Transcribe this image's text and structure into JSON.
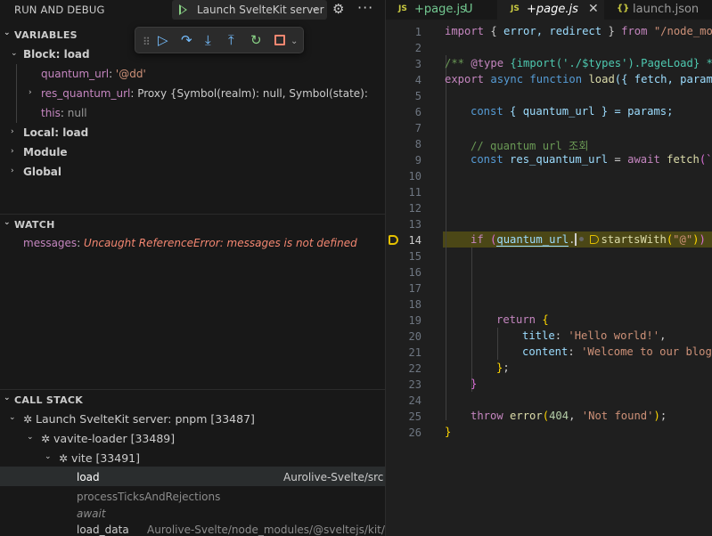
{
  "debug_bar": {
    "title": "RUN AND DEBUG",
    "launch_config": "Launch SvelteKit server",
    "play_icon": "play-icon",
    "settings_icon": "gear-icon",
    "more_icon": "ellipsis-icon"
  },
  "toolbar": {
    "icons": [
      "gripper-icon",
      "continue-icon",
      "step-over-icon",
      "step-into-icon",
      "step-out-icon",
      "restart-icon",
      "stop-icon",
      "chevron-down-icon"
    ]
  },
  "variables": {
    "header": "VARIABLES",
    "block_scope": "Block: load",
    "items": [
      {
        "name": "quantum_url",
        "sep": ": ",
        "value": "'@dd'"
      },
      {
        "name": "res_quantum_url",
        "sep": ": ",
        "value": "Proxy {Symbol(realm): null, Symbol(state): "
      },
      {
        "name": "this",
        "sep": ": ",
        "value": "null"
      }
    ],
    "scopes": [
      "Local: load",
      "Module",
      "Global"
    ]
  },
  "watch": {
    "header": "WATCH",
    "expr": "messages",
    "sep": ": ",
    "value": "Uncaught ReferenceError: messages is not defined"
  },
  "call_stack": {
    "header": "CALL STACK",
    "session": "Launch SvelteKit server: pnpm [33487]",
    "child": "vavite-loader [33489]",
    "grandchild": "vite [33491]",
    "frames": [
      {
        "name": "load",
        "source": "Aurolive-Svelte/src"
      },
      {
        "name": "processTicksAndRejections",
        "source": ""
      },
      {
        "name": "await",
        "source": ""
      },
      {
        "name": "load_data",
        "source": "Aurolive-Svelte/node_modules/@sveltejs/kit/"
      }
    ]
  },
  "tabs": [
    {
      "badge": "JS",
      "label": "+page.js",
      "status": "U",
      "active": false
    },
    {
      "badge": "JS",
      "label": "+page.js",
      "status": "",
      "active": true
    },
    {
      "badge": "{}",
      "label": "launch.json",
      "status": "",
      "active": false
    }
  ],
  "editor": {
    "current_line": 14,
    "line_numbers": [
      "1",
      "2",
      "3",
      "4",
      "5",
      "6",
      "7",
      "8",
      "9",
      "10",
      "11",
      "12",
      "13",
      "14",
      "15",
      "16",
      "17",
      "18",
      "19",
      "20",
      "21",
      "22",
      "23",
      "24",
      "25",
      "26"
    ],
    "code": {
      "l1_import": "import",
      "l1_brace_open": " { ",
      "l1_names": "error, redirect",
      "l1_brace_close": " } ",
      "l1_from": "from",
      "l1_path": " \"/node_modules/@sveltejs/kit\"",
      "l3_comment_start": "/** ",
      "l3_type_tag": "@type",
      "l3_type": " {import('./$types').PageLoad} */",
      "l4_export": "export",
      "l4_async": " async",
      "l4_function": " function",
      "l4_name": " load",
      "l4_params": "({ fetch, params }) {",
      "l6_const": "const",
      "l6_rest": " { quantum_url } = params;",
      "l8_comment": "// quantum url 조회",
      "l9_const": "const",
      "l9_var": " res_quantum_url",
      "l9_eq": " = ",
      "l9_await": "await",
      "l9_fetch": " fetch",
      "l9_rest": "(`/api/quantum/${quantum_url}`);",
      "l14_if": "if",
      "l14_var": "quantum_url",
      "l14_method": "startsWith",
      "l14_str": "\"@\"",
      "l19_return": "return",
      "l20_key": "title",
      "l20_val": "'Hello world!'",
      "l21_key": "content",
      "l21_val": "'Welcome to our blog.'",
      "l25_throw": "throw",
      "l25_fn": "error",
      "l25_num": "404",
      "l25_str": "'Not found'"
    }
  }
}
